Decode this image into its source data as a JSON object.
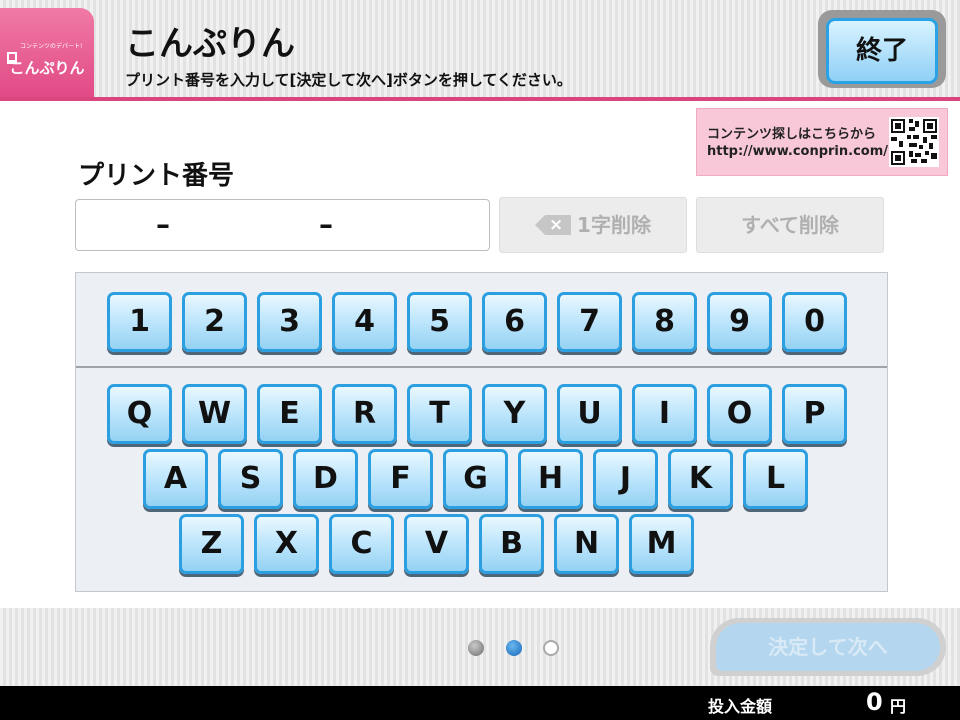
{
  "header": {
    "logo_tagline": "コンテンツのデパート!",
    "logo_brand": "こんぷりん",
    "title": "こんぷりん",
    "instruction": "プリント番号を入力して[決定して次へ]ボタンを押してください。",
    "end_label": "終了"
  },
  "promo": {
    "line1": "コンテンツ探しはこちらから",
    "line2": "http://www.conprin.com/",
    "qr_icon": "qr-code-icon"
  },
  "print_number": {
    "label": "プリント番号",
    "segment_separators": [
      "–",
      "–"
    ],
    "value": ""
  },
  "controls": {
    "delete_one": "1字削除",
    "delete_all": "すべて削除",
    "backspace_icon": "backspace-icon",
    "backspace_glyph": "×"
  },
  "keyboard": {
    "numbers": [
      "1",
      "2",
      "3",
      "4",
      "5",
      "6",
      "7",
      "8",
      "9",
      "0"
    ],
    "row1": [
      "Q",
      "W",
      "E",
      "R",
      "T",
      "Y",
      "U",
      "I",
      "O",
      "P"
    ],
    "row2": [
      "A",
      "S",
      "D",
      "F",
      "G",
      "H",
      "J",
      "K",
      "L"
    ],
    "row3": [
      "Z",
      "X",
      "C",
      "V",
      "B",
      "N",
      "M"
    ]
  },
  "pagination": {
    "pages": 3,
    "current": 2
  },
  "next_button": {
    "label": "決定して次へ",
    "enabled": false
  },
  "status": {
    "inserted_label": "投入金額",
    "amount": "0",
    "unit": "円"
  },
  "colors": {
    "accent_pink": "#d9457d",
    "key_border_blue": "#2c9fe0",
    "page_dot_active": "#1565b9"
  }
}
